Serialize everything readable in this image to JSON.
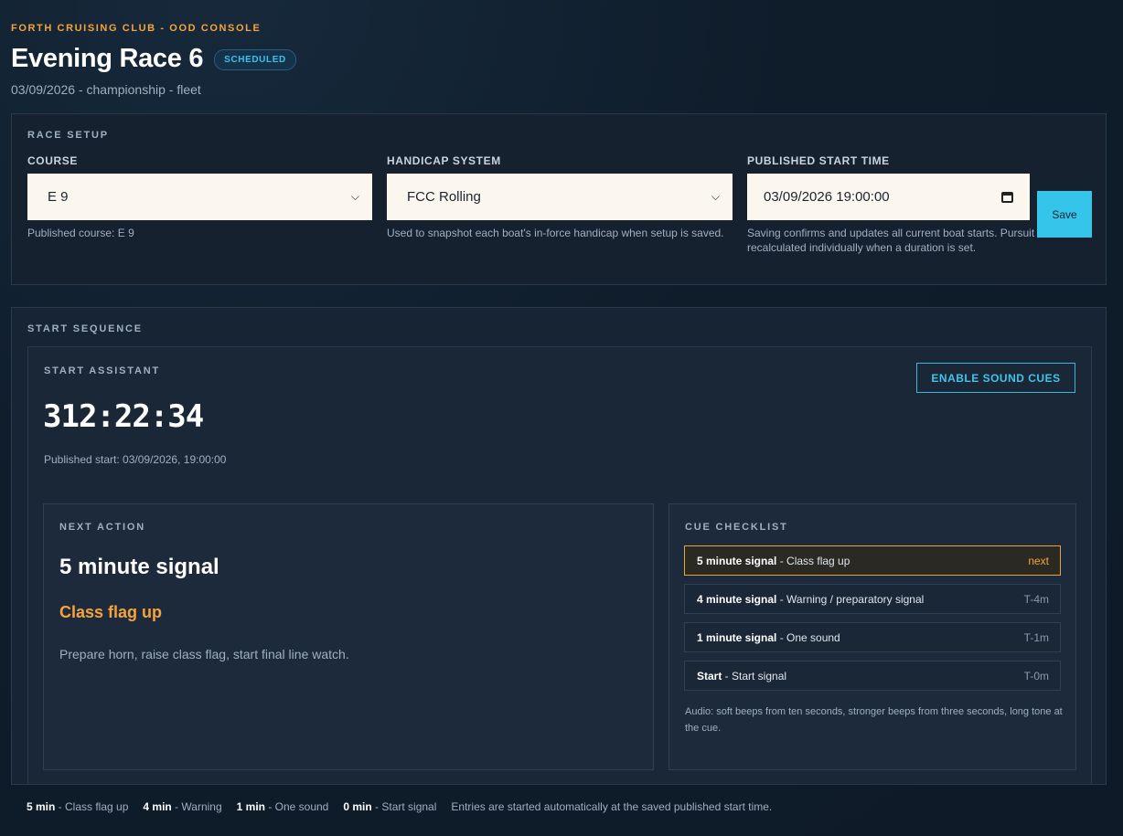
{
  "header": {
    "eyebrow": "FORTH CRUISING CLUB - OOD CONSOLE",
    "title": "Evening Race 6",
    "status": "SCHEDULED",
    "subtitle": "03/09/2026 - championship - fleet"
  },
  "race_setup": {
    "section_label": "RACE SETUP",
    "course": {
      "label": "COURSE",
      "value": "E 9",
      "help": "Published course: E 9"
    },
    "handicap": {
      "label": "HANDICAP SYSTEM",
      "value": "FCC Rolling",
      "help": "Used to snapshot each boat's in-force handicap when setup is saved."
    },
    "start_time": {
      "label": "PUBLISHED START TIME",
      "value": "03/09/2026 19:00:00",
      "save_label": "Save",
      "help": "Saving confirms and updates all current boat starts. Pursuit starts are recalculated individually when a duration is set."
    }
  },
  "start_sequence": {
    "section_label": "START SEQUENCE",
    "assistant": {
      "label": "START ASSISTANT",
      "sound_button": "ENABLE SOUND CUES",
      "countdown": "312:22:34",
      "published_start": "Published start: 03/09/2026, 19:00:00"
    },
    "next_action": {
      "label": "NEXT ACTION",
      "title": "5 minute signal",
      "subtitle": "Class flag up",
      "description": "Prepare horn, raise class flag, start final line watch."
    },
    "cue_checklist": {
      "label": "CUE CHECKLIST",
      "items": [
        {
          "name": "5 minute signal",
          "detail": " - Class flag up",
          "tag": "next"
        },
        {
          "name": "4 minute signal",
          "detail": " - Warning / preparatory signal",
          "tag": "T-4m"
        },
        {
          "name": "1 minute signal",
          "detail": " - One sound",
          "tag": "T-1m"
        },
        {
          "name": "Start",
          "detail": " - Start signal",
          "tag": "T-0m"
        }
      ],
      "audio_note": "Audio: soft beeps from ten seconds, stronger beeps from three seconds, long tone at the cue."
    }
  },
  "legend": {
    "items": [
      {
        "time": "5 min",
        "text": " - Class flag up"
      },
      {
        "time": "4 min",
        "text": " - Warning"
      },
      {
        "time": "1 min",
        "text": " - One sound"
      },
      {
        "time": "0 min",
        "text": " - Start signal"
      }
    ],
    "note": "Entries are started automatically at the saved published start time."
  },
  "colors": {
    "accent_orange": "#f4a43a",
    "accent_cyan": "#35c4ea",
    "background": "#0f1c2a"
  }
}
